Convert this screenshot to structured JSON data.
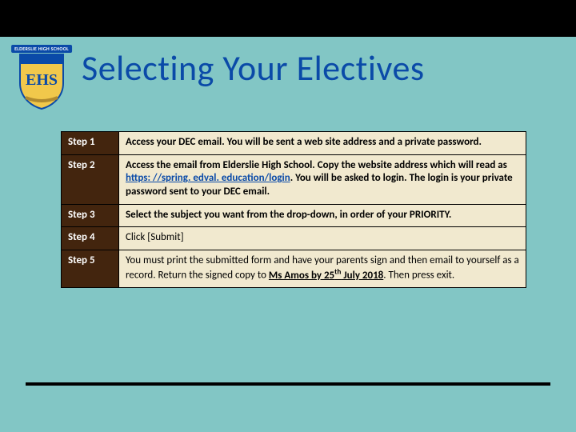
{
  "logo": {
    "banner": "ELDERSLIE HIGH SCHOOL",
    "monogram": "EHS"
  },
  "title": "Selecting Your Electives",
  "steps": [
    {
      "label": "Step 1"
    },
    {
      "label": "Step 2"
    },
    {
      "label": "Step 3"
    },
    {
      "label": "Step 4"
    },
    {
      "label": "Step 5"
    }
  ],
  "desc": {
    "s1": "Access your DEC email.  You will be sent a web site address and a private password.",
    "s2a": "Access the email from Elderslie High School.  Copy the website address which will read as ",
    "s2link": "https: //spring. edval. education/login",
    "s2b": ".  You will be asked to login.  The login is your private password sent to your DEC email.",
    "s3": "Select the subject you want from the drop-down, in order of your PRIORITY.",
    "s4": "Click [Submit]",
    "s5a": "You must print the submitted form and have your parents sign and then email to yourself as a record.  Return the signed copy to ",
    "s5u": "Ms Amos by 25",
    "s5th": "th",
    "s5u2": " July 2018",
    "s5b": ".  Then press exit."
  },
  "colors": {
    "bg": "#82c6c5",
    "accent": "#0a4aa8",
    "stepbg": "#43250e",
    "descbg": "#f1e9cf"
  }
}
